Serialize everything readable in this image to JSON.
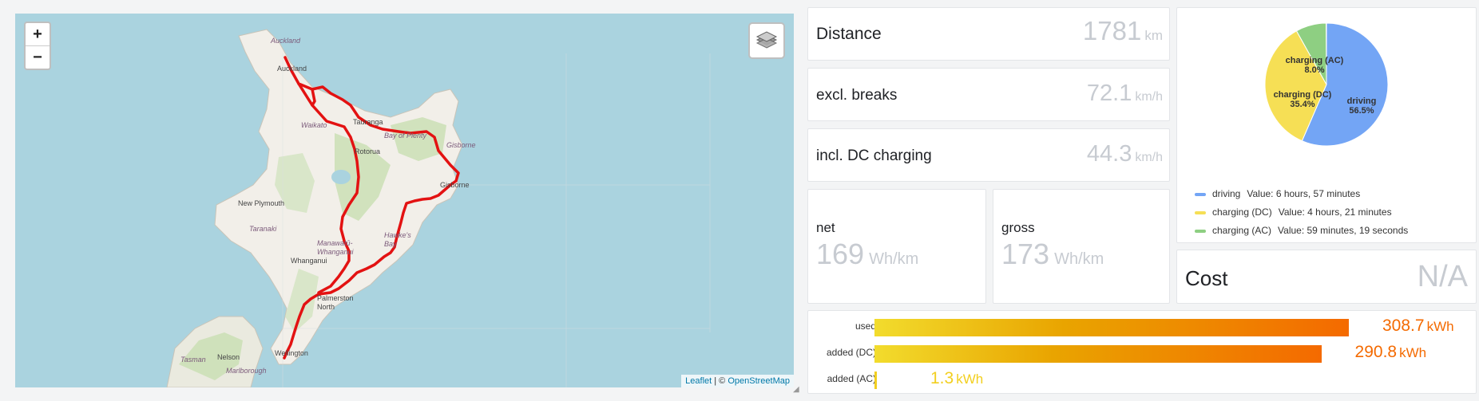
{
  "map": {
    "zoom_in": "+",
    "zoom_out": "−",
    "layers_icon": "layers-icon",
    "attribution": {
      "leaflet": "Leaflet",
      "separator": " | © ",
      "osm": "OpenStreetMap"
    },
    "labels": {
      "auckland_region": "Auckland",
      "auckland": "Auckland",
      "waikato": "Waikato",
      "tauranga": "Tauranga",
      "bay_of_plenty": "Bay of Plenty",
      "rotorua": "Rotorua",
      "gisborne_region": "Gisborne",
      "gisborne": "Gisborne",
      "new_plymouth": "New Plymouth",
      "taranaki": "Taranaki",
      "manawatu": "Manawatū-Whanganui",
      "whanganui": "Whanganui",
      "hawkes_bay": "Hawke's Bay",
      "palmerston_north": "Palmerston North",
      "wellington": "Wellington",
      "nelson": "Nelson",
      "tasman": "Tasman",
      "marlborough": "Marlborough"
    }
  },
  "stats": {
    "distance": {
      "title": "Distance",
      "value": "1781",
      "unit": "km"
    },
    "excl_breaks": {
      "title": "excl. breaks",
      "value": "72.1",
      "unit": "km/h"
    },
    "incl_dc": {
      "title": "incl. DC charging",
      "value": "44.3",
      "unit": "km/h"
    },
    "net": {
      "title": "net",
      "value": "169",
      "unit": "Wh/km"
    },
    "gross": {
      "title": "gross",
      "value": "173",
      "unit": "Wh/km"
    },
    "cost": {
      "title": "Cost",
      "value": "N/A"
    }
  },
  "pie": {
    "colors": {
      "driving": "#73a5f5",
      "charging_dc": "#f6df55",
      "charging_ac": "#8ecf82"
    },
    "slices": [
      {
        "name": "driving",
        "label": "driving",
        "percent_label": "56.5%",
        "percent": 56.5,
        "legend_value": "Value: 6 hours, 57 minutes",
        "color": "#73a5f5"
      },
      {
        "name": "charging (DC)",
        "label": "charging (DC)",
        "percent_label": "35.4%",
        "percent": 35.4,
        "legend_value": "Value: 4 hours, 21 minutes",
        "color": "#f6df55"
      },
      {
        "name": "charging (AC)",
        "label": "charging (AC)",
        "percent_label": "8.0%",
        "percent": 8.0,
        "legend_value": "Value: 59 minutes, 19 seconds",
        "color": "#8ecf82"
      }
    ]
  },
  "energy": {
    "max": 308.7,
    "unit": "kWh",
    "bars": [
      {
        "label": "used",
        "value": 308.7,
        "value_text": "308.7",
        "color": "#f46a00"
      },
      {
        "label": "added (DC)",
        "value": 290.8,
        "value_text": "290.8",
        "color": "#f46a00"
      },
      {
        "label": "added (AC)",
        "value": 1.3,
        "value_text": "1.3",
        "color": "#f2cf1f"
      }
    ]
  }
}
